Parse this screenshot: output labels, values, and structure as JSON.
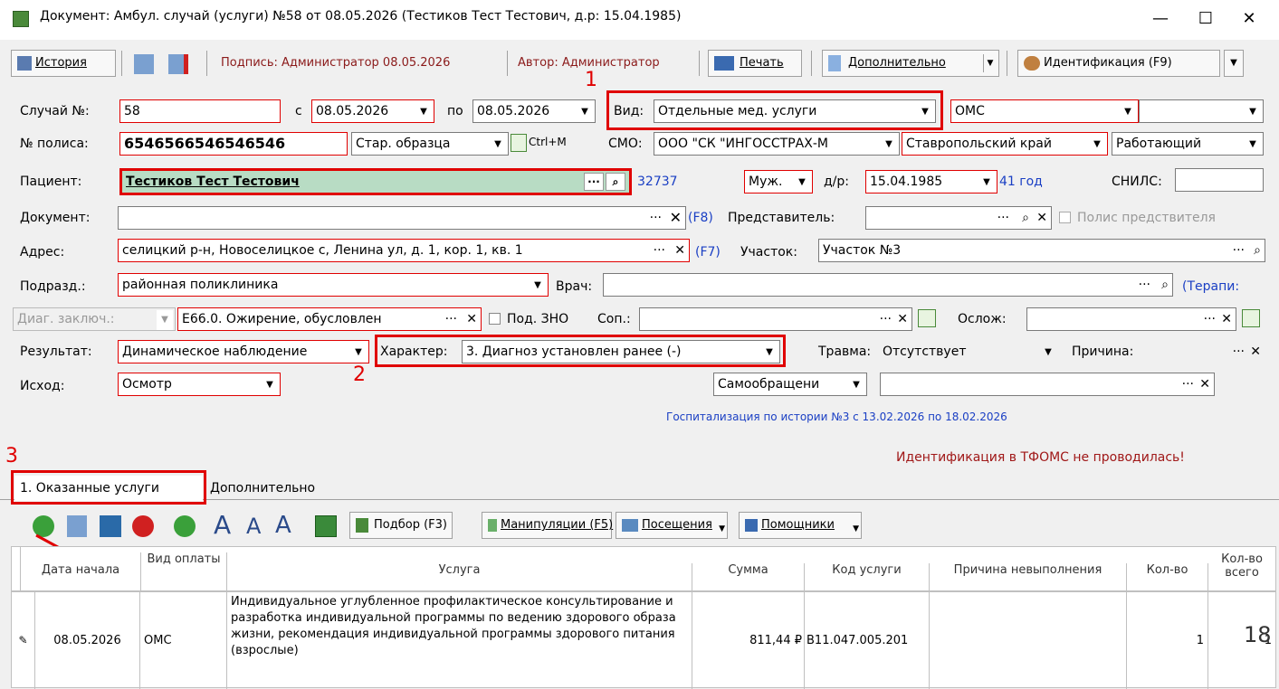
{
  "window": {
    "title": "Документ: Амбул. случай (услуги) №58 от 08.05.2026 (Тестиков Тест Тестович, д.р: 15.04.1985)",
    "min": "—",
    "max": "☐",
    "close": "✕"
  },
  "toolbar": {
    "history": "История",
    "signature": "Подпись: Администратор 08.05.2026",
    "author": "Автор: Администратор",
    "print": "Печать",
    "additional": "Дополнительно",
    "identification": "Идентификация (F9)"
  },
  "form": {
    "case_label": "Случай №:",
    "case_no": "58",
    "from_label": "с",
    "from_date": "08.05.2026",
    "to_label": "по",
    "to_date": "08.05.2026",
    "type_label": "Вид:",
    "type_value": "Отдельные мед. услуги",
    "pay_value": "ОМС",
    "policy_label": "№ полиса:",
    "policy_no": "6546566546546546",
    "policy_kind": "Стар. образца",
    "ctrlm": "Ctrl+M",
    "smo_label": "СМО:",
    "smo_value": "ООО \"СК \"ИНГОССТРАХ-М",
    "region": "Ставропольский край",
    "work": "Работающий",
    "patient_label": "Пациент:",
    "patient": "Тестиков Тест Тестович",
    "patient_id": "32737",
    "sex": "Муж.",
    "dob_label": "д/р:",
    "dob": "15.04.1985",
    "age": "41 год",
    "snils_label": "СНИЛС:",
    "doc_label": "Документ:",
    "f8": "(F8)",
    "rep_label": "Представитель:",
    "rep_policy": "Полис предствителя",
    "addr_label": "Адрес:",
    "addr": "селицкий р-н, Новоселицкое с, Ленина ул, д. 1, кор. 1, кв. 1",
    "f7": "(F7)",
    "district_label": "Участок:",
    "district": "Участок №3",
    "dept_label": "Подразд.:",
    "dept": "районная поликлиника",
    "doctor_label": "Врач:",
    "doctor_spec": "(Терапи:",
    "diag_label": "Диаг. заключ.:",
    "diag": "E66.0. Ожирение, обусловлен",
    "zno": "Под. ЗНО",
    "sop_label": "Соп.:",
    "complic_label": "Ослож:",
    "result_label": "Результат:",
    "result": "Динамическое наблюдение",
    "character_label": "Характер:",
    "character": "3. Диагноз установлен ранее (-)",
    "trauma_label": "Травма:",
    "trauma": "Отсутствует",
    "reason_label": "Причина:",
    "outcome_label": "Исход:",
    "outcome": "Осмотр",
    "self_referral": "Самообращени",
    "hospital_note": "Госпитализация по истории №3 с 13.02.2026 по 18.02.2026",
    "tfoms_note": "Идентификация в ТФОМС не проводилась!"
  },
  "annotations": {
    "n1": "1",
    "n2": "2",
    "n3": "3"
  },
  "tabs": {
    "tab1": "1. Оказанные услуги",
    "tab2": "Дополнительно"
  },
  "gridbar": {
    "selection": "Подбор (F3)",
    "manipulations": "Манипуляции (F5)",
    "visits": "Посещения",
    "helpers": "Помощники"
  },
  "grid": {
    "headers": {
      "start": "Дата начала",
      "paytype": "Вид оплаты",
      "service": "Услуга",
      "sum": "Сумма",
      "code": "Код услуги",
      "reason": "Причина невыполнения",
      "qty": "Кол-во",
      "qty_total": "Кол-во всего"
    },
    "row": {
      "start": "08.05.2026",
      "paytype": "ОМС",
      "service": "Индивидуальное углубленное профилактическое консультирование и разработка индивидуальной программы по ведению здорового образа жизни, рекомендация индивидуальной программы здорового питания (взрослые)",
      "sum": "811,44 ₽",
      "code": "B11.047.005.201",
      "qty": "1",
      "qty_total": "1"
    }
  },
  "overlay_num": "18"
}
